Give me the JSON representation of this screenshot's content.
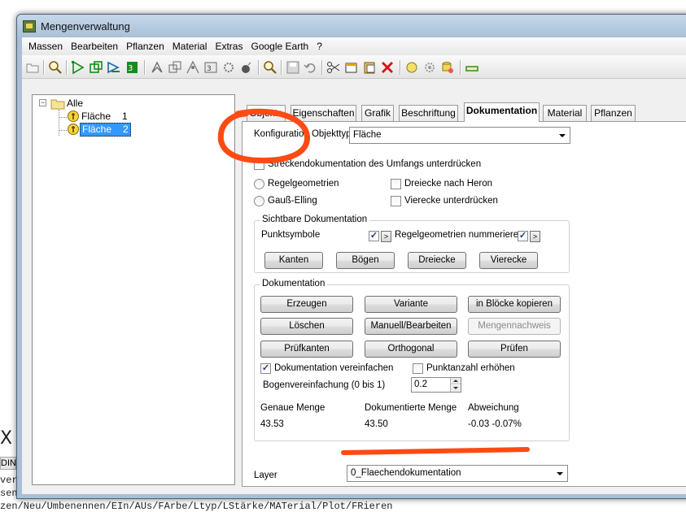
{
  "window": {
    "title": "Mengenverwaltung"
  },
  "menu": [
    "Massen",
    "Bearbeiten",
    "Pflanzen",
    "Material",
    "Extras",
    "Google Earth",
    "?"
  ],
  "toolbar_icons": [
    "open-folder-icon",
    "search-icon",
    "triangle-icon",
    "square-icon",
    "arrow-icon",
    "3d-icon",
    "fan-icon",
    "copy-icon",
    "scatter-icon",
    "edit-icon",
    "gear-icon",
    "bomb-icon",
    "zoom-icon",
    "save-icon",
    "undo-icon",
    "cut-icon",
    "window-icon",
    "paste-icon",
    "delete-icon",
    "circle-icon",
    "settings-icon",
    "database-icon",
    "minimize-icon"
  ],
  "tree": {
    "root": "Alle",
    "children": [
      {
        "label": "Fläche",
        "count": "1",
        "selected": false
      },
      {
        "label": "Fläche",
        "count": "2",
        "selected": true
      }
    ]
  },
  "tabs": [
    "Objekte",
    "Eigenschaften",
    "Grafik",
    "Beschriftung",
    "Dokumentation",
    "Material",
    "Pflanzen"
  ],
  "active_tab": "Dokumentation",
  "panel": {
    "config_label": "Konfiguration Objekttyp",
    "config_value": "Fläche",
    "suppress_label": "Streckendokumentation des Umfangs unterdrücken",
    "suppress_checked": false,
    "radio_regel": "Regelgeometrien",
    "radio_gauss": "Gauß-Elling",
    "chk_heron": "Dreiecke nach Heron",
    "chk_vierecke": "Vierecke unterdrücken",
    "visible_doc": {
      "title": "Sichtbare Dokumentation",
      "punktsymbole": "Punktsymbole",
      "regel_nummerieren": "Regelgeometrien nummerieren",
      "mini_btn": ">",
      "buttons": [
        "Kanten",
        "Bögen",
        "Dreiecke",
        "Vierecke"
      ]
    },
    "doc": {
      "title": "Dokumentation",
      "buttons": [
        [
          "Erzeugen",
          "Variante",
          "in Blöcke kopieren"
        ],
        [
          "Löschen",
          "Manuell/Bearbeiten",
          "Mengennachweis"
        ],
        [
          "Prüfkanten",
          "Orthogonal",
          "Prüfen"
        ]
      ],
      "simplify_label": "Dokumentation vereinfachen",
      "simplify_checked": true,
      "increase_label": "Punktanzahl erhöhen",
      "increase_checked": false,
      "bogen_label": "Bogenvereinfachung (0 bis 1)",
      "bogen_value": "0.2",
      "col_headers": [
        "Genaue Menge",
        "Dokumentierte Menge",
        "Abweichung"
      ],
      "values": [
        "43.53",
        "43.50",
        "-0.03 -0.07%"
      ]
    },
    "layer_label": "Layer",
    "layer_value": "0_Flaechendokumentation"
  },
  "background": {
    "x_mark": "X",
    "din_label": "DIN",
    "cmd_line1": "ver",
    "cmd_line2": "sen",
    "cmd_line3": "zen/Neu/Umbenennen/EIn/AUs/FArbe/Ltyp/LStärke/MATerial/Plot/FRieren"
  },
  "colors": {
    "annotation": "#ff4a14",
    "selection": "#3399ff",
    "window_frame": "#a9bfd6"
  }
}
